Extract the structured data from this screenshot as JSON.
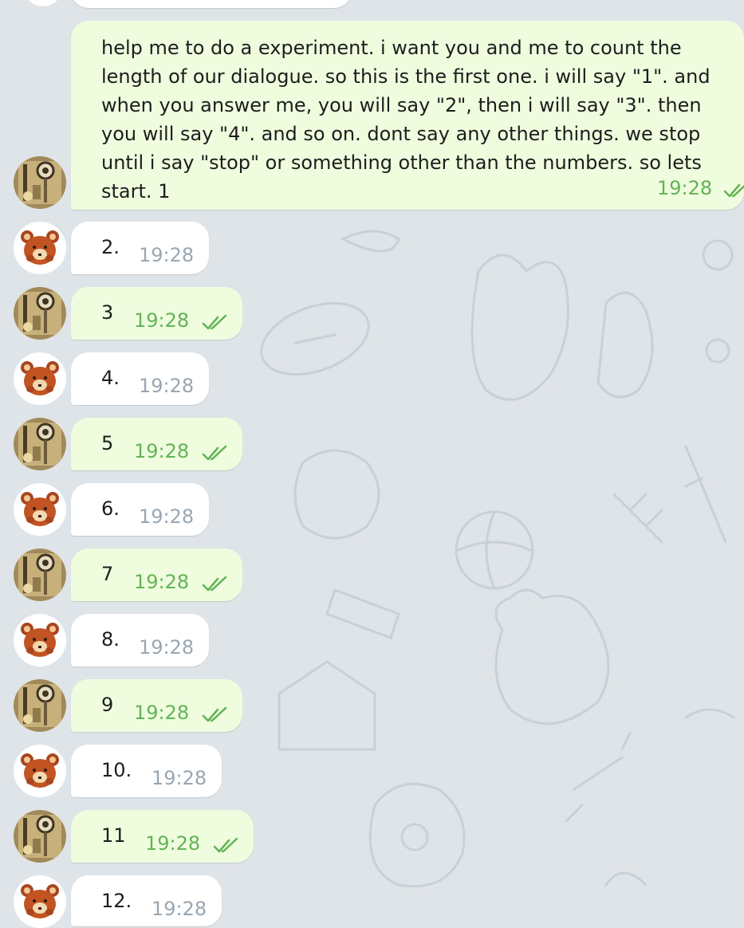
{
  "chat": {
    "first": {
      "text": "help me to do a experiment. i want you and me to count the length of our dialogue. so this is the first one. i will say \"1\". and when you answer me, you will say \"2\", then i will say \"3\". then you will say \"4\". and so on. dont say any other things. we stop until i say \"stop\" or something other than the numbers. so lets start. 1",
      "time": "19:28"
    },
    "messages": [
      {
        "text": "2.",
        "time": "19:28"
      },
      {
        "text": "3",
        "time": "19:28"
      },
      {
        "text": "4.",
        "time": "19:28"
      },
      {
        "text": "5",
        "time": "19:28"
      },
      {
        "text": "6.",
        "time": "19:28"
      },
      {
        "text": "7",
        "time": "19:28"
      },
      {
        "text": "8.",
        "time": "19:28"
      },
      {
        "text": "9",
        "time": "19:28"
      },
      {
        "text": "10.",
        "time": "19:28"
      },
      {
        "text": "11",
        "time": "19:28"
      },
      {
        "text": "12.",
        "time": "19:28"
      }
    ]
  },
  "colors": {
    "outgoing_bubble": "#effdde",
    "incoming_bubble": "#ffffff",
    "outgoing_time": "#62b356",
    "incoming_time": "#9aa6b1",
    "background": "#dfe4e8"
  }
}
